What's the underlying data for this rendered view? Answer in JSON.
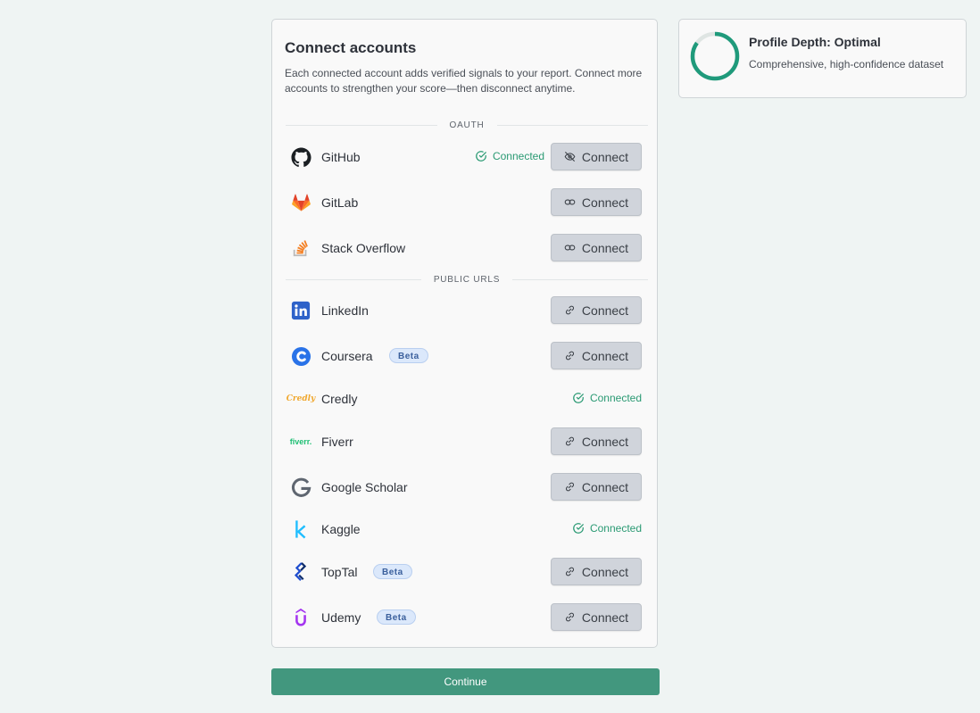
{
  "card": {
    "title": "Connect accounts",
    "description": "Each connected account adds verified signals to your report. Connect more accounts to strengthen your score—then disconnect anytime."
  },
  "sections": {
    "oauth": "OAUTH",
    "public": "PUBLIC URLS"
  },
  "accounts": [
    {
      "name": "GitHub",
      "icon": "github-icon",
      "status": "Connected",
      "button": "Connect",
      "button_icon": "eye-off-icon"
    },
    {
      "name": "GitLab",
      "icon": "gitlab-icon",
      "button": "Connect",
      "button_icon": "link-icon"
    },
    {
      "name": "Stack Overflow",
      "icon": "stackoverflow-icon",
      "button": "Connect",
      "button_icon": "link-icon"
    },
    {
      "name": "LinkedIn",
      "icon": "linkedin-icon",
      "button": "Connect",
      "button_icon": "link-icon"
    },
    {
      "name": "Coursera",
      "icon": "coursera-icon",
      "badge": "Beta",
      "button": "Connect",
      "button_icon": "link-icon"
    },
    {
      "name": "Credly",
      "icon": "credly-icon",
      "logo_text": "Credly",
      "status": "Connected"
    },
    {
      "name": "Fiverr",
      "icon": "fiverr-icon",
      "logo_text": "fiverr.",
      "button": "Connect",
      "button_icon": "link-icon"
    },
    {
      "name": "Google Scholar",
      "icon": "google-icon",
      "button": "Connect",
      "button_icon": "link-icon"
    },
    {
      "name": "Kaggle",
      "icon": "kaggle-icon",
      "status": "Connected"
    },
    {
      "name": "TopTal",
      "icon": "toptal-icon",
      "badge": "Beta",
      "button": "Connect",
      "button_icon": "link-icon"
    },
    {
      "name": "Udemy",
      "icon": "udemy-icon",
      "badge": "Beta",
      "button": "Connect",
      "button_icon": "link-icon"
    }
  ],
  "continue_label": "Continue",
  "profile_depth": {
    "title": "Profile Depth: Optimal",
    "subtitle": "Comprehensive, high-confidence dataset",
    "progress": 0.85
  },
  "colors": {
    "accent": "#42977e",
    "connected": "#2a9a73",
    "button_bg": "#d0d4db"
  }
}
